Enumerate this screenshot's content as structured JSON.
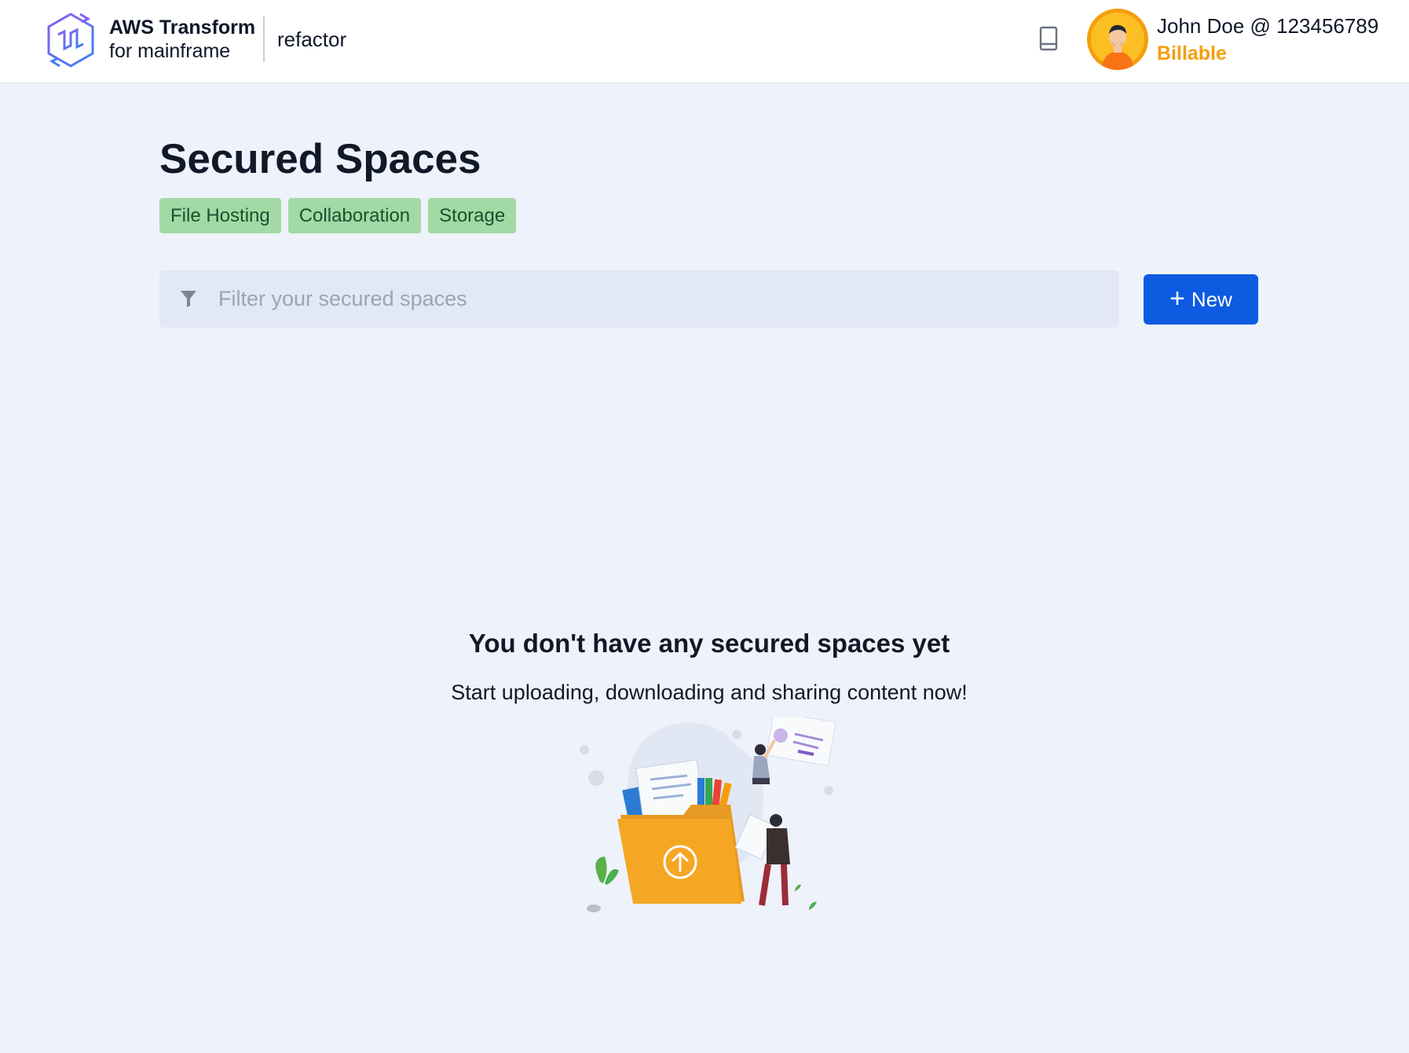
{
  "header": {
    "brand_title": "AWS Transform",
    "brand_subtitle": "for mainframe",
    "product": "refactor",
    "user_name": "John Doe @ 123456789",
    "user_status": "Billable"
  },
  "page": {
    "title": "Secured Spaces",
    "tags": [
      "File Hosting",
      "Collaboration",
      "Storage"
    ]
  },
  "filter": {
    "placeholder": "Filter your secured spaces",
    "value": ""
  },
  "actions": {
    "new_label": "New"
  },
  "empty_state": {
    "title": "You don't have any secured spaces yet",
    "subtitle": "Start uploading, downloading and sharing content now!"
  },
  "icons": {
    "logo": "hexagon-transform-logo",
    "docs": "book-icon",
    "filter": "funnel-icon",
    "new": "plus-icon",
    "upload": "arrow-up-circle-icon"
  },
  "colors": {
    "accent": "#0d5be1",
    "tag_bg": "#a3d9a5",
    "tag_text": "#14532d",
    "status": "#f59e0b",
    "background": "#eef2fa"
  }
}
